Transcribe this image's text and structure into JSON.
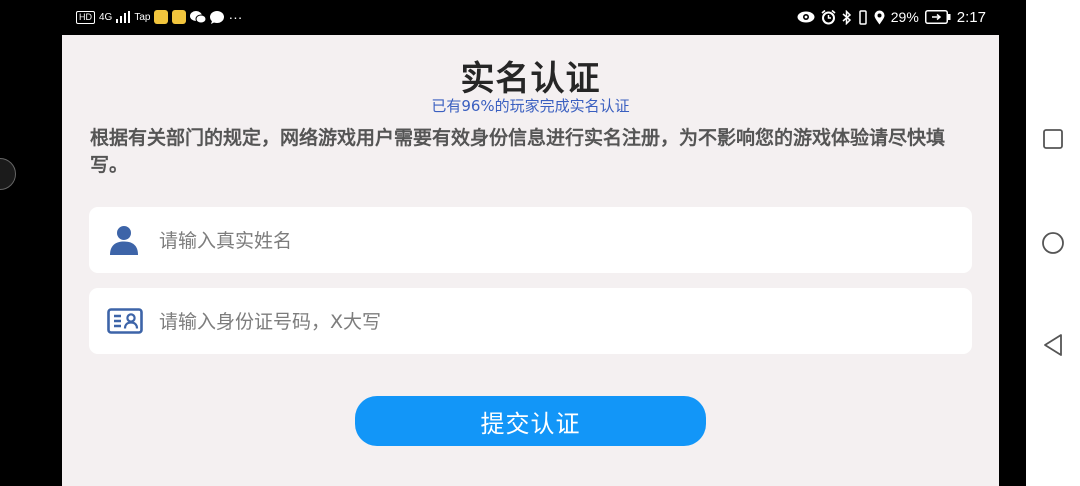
{
  "status_bar": {
    "hd": "HD",
    "network": "4G",
    "tap": "Tap",
    "more": "···",
    "battery_percent": "29%",
    "time": "2:17",
    "icons_left": [
      "hd-icon",
      "signal-icon",
      "taptap-icon",
      "app-icon",
      "app-icon",
      "wechat-icon",
      "message-icon"
    ],
    "icons_right": [
      "eye-icon",
      "alarm-icon",
      "bluetooth-icon",
      "vibrate-icon",
      "location-icon",
      "battery-icon"
    ]
  },
  "dialog": {
    "title": "实名认证",
    "subtitle": "已有96%的玩家完成实名认证",
    "description": "根据有关部门的规定，网络游戏用户需要有效身份信息进行实名注册，为不影响您的游戏体验请尽快填写。",
    "name_field": {
      "placeholder": "请输入真实姓名",
      "value": "",
      "icon": "person-icon"
    },
    "id_field": {
      "placeholder": "请输入身份证号码，X大写",
      "value": "",
      "icon": "id-card-icon"
    },
    "submit_label": "提交认证"
  },
  "nav_bar": {
    "buttons": [
      "recent-apps-button",
      "home-button",
      "back-button"
    ]
  },
  "colors": {
    "card_bg": "#f4f0f1",
    "accent": "#1296f8",
    "subtitle": "#3a5fc0",
    "icon": "#3d64a8"
  }
}
